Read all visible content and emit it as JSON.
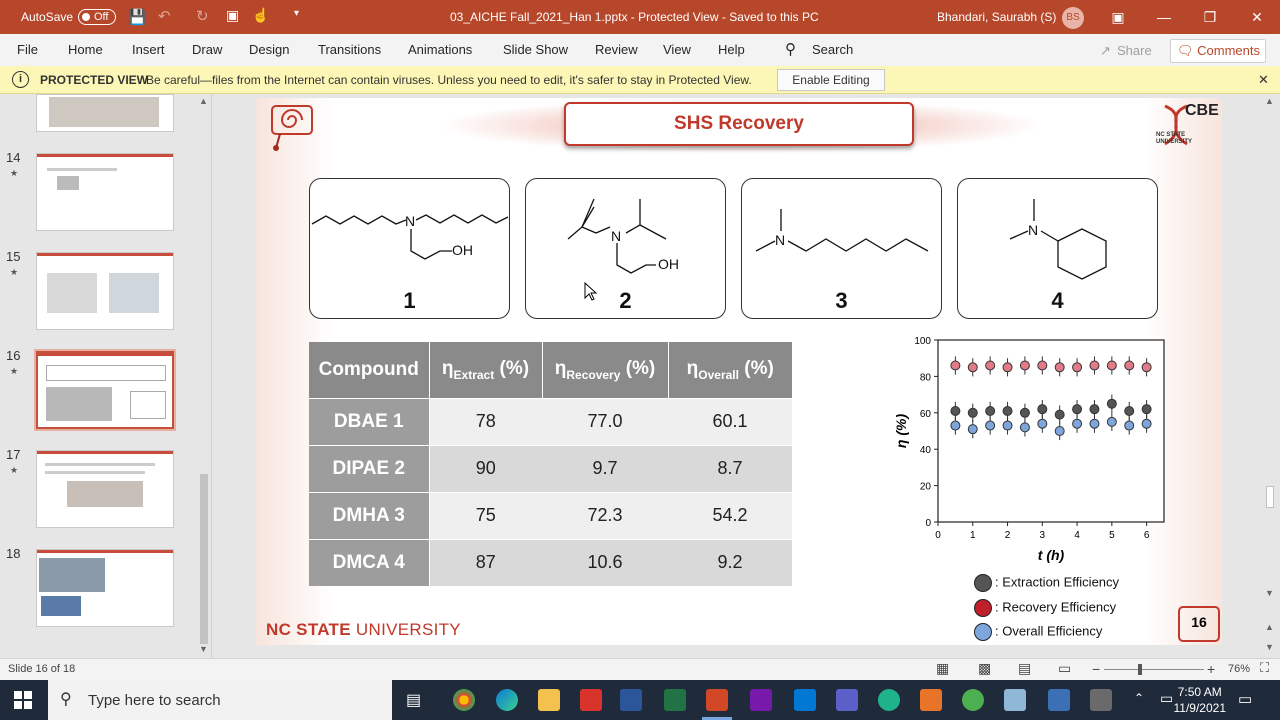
{
  "titlebar": {
    "autosave_label": "AutoSave",
    "autosave_state": "Off",
    "document_title": "03_AICHE Fall_2021_Han 1.pptx  -  Protected View  -  Saved to this PC",
    "user_name": "Bhandari, Saurabh (S)",
    "user_initials": "BS"
  },
  "menu": {
    "items": [
      "File",
      "Home",
      "Insert",
      "Draw",
      "Design",
      "Transitions",
      "Animations",
      "Slide Show",
      "Review",
      "View",
      "Help"
    ],
    "search_label": "Search",
    "share_label": "Share",
    "comments_label": "Comments"
  },
  "protected_view": {
    "title": "PROTECTED VIEW",
    "message": "Be careful—files from the Internet can contain viruses. Unless you need to edit, it's safer to stay in Protected View.",
    "button_label": "Enable Editing"
  },
  "thumbnails": [
    {
      "number": "14"
    },
    {
      "number": "15"
    },
    {
      "number": "16"
    },
    {
      "number": "17"
    },
    {
      "number": "18"
    }
  ],
  "slide": {
    "title": "SHS Recovery",
    "molecules": [
      {
        "number": "1"
      },
      {
        "number": "2"
      },
      {
        "number": "3"
      },
      {
        "number": "4"
      }
    ],
    "atom_labels": {
      "n": "N",
      "oh": "OH"
    },
    "logo_text": "CBE",
    "logo_subtext": "NC STATE UNIVERSITY",
    "table": {
      "header_compound": "Compound",
      "header_extract": "Extract",
      "header_recovery": "Recovery",
      "header_overall": "Overall",
      "eta": "η",
      "pct": "(%)",
      "rows": [
        {
          "name": "DBAE 1",
          "extract": "78",
          "recovery": "77.0",
          "overall": "60.1"
        },
        {
          "name": "DIPAE 2",
          "extract": "90",
          "recovery": "9.7",
          "overall": "8.7"
        },
        {
          "name": "DMHA 3",
          "extract": "75",
          "recovery": "72.3",
          "overall": "54.2"
        },
        {
          "name": "DMCA 4",
          "extract": "87",
          "recovery": "10.6",
          "overall": "9.2"
        }
      ]
    },
    "footer_nc": "NC STATE",
    "footer_univ": " UNIVERSITY",
    "page_number": "16"
  },
  "chart_data": {
    "type": "scatter",
    "xlabel": "t (h)",
    "ylabel": "η (%)",
    "xlim": [
      0,
      6.5
    ],
    "ylim": [
      0,
      100
    ],
    "xticks": [
      "0",
      "1",
      "2",
      "3",
      "4",
      "5",
      "6"
    ],
    "yticks": [
      "0",
      "20",
      "40",
      "60",
      "80",
      "100"
    ],
    "series": [
      {
        "name": ": Extraction Efficiency",
        "color": "#555555",
        "x": [
          0.5,
          1.0,
          1.5,
          2.0,
          2.5,
          3.0,
          3.5,
          4.0,
          4.5,
          5.0,
          5.5,
          6.0
        ],
        "y": [
          61,
          60,
          61,
          61,
          60,
          62,
          59,
          62,
          62,
          65,
          61,
          62
        ]
      },
      {
        "name": ": Recovery Efficiency",
        "color": "#e07b87",
        "x": [
          0.5,
          1.0,
          1.5,
          2.0,
          2.5,
          3.0,
          3.5,
          4.0,
          4.5,
          5.0,
          5.5,
          6.0
        ],
        "y": [
          86,
          85,
          86,
          85,
          86,
          86,
          85,
          85,
          86,
          86,
          86,
          85
        ]
      },
      {
        "name": ": Overall Efficiency",
        "color": "#7ea6dc",
        "x": [
          0.5,
          1.0,
          1.5,
          2.0,
          2.5,
          3.0,
          3.5,
          4.0,
          4.5,
          5.0,
          5.5,
          6.0
        ],
        "y": [
          53,
          51,
          53,
          53,
          52,
          54,
          50,
          54,
          54,
          55,
          53,
          54
        ]
      }
    ],
    "error": 5
  },
  "status": {
    "slide_label": "Slide 16 of 18",
    "zoom": "76%",
    "zoom_minus": "−",
    "zoom_plus": "+"
  },
  "taskbar": {
    "search_placeholder": "Type here to search",
    "time": "7:50 AM",
    "date": "11/9/2021"
  }
}
